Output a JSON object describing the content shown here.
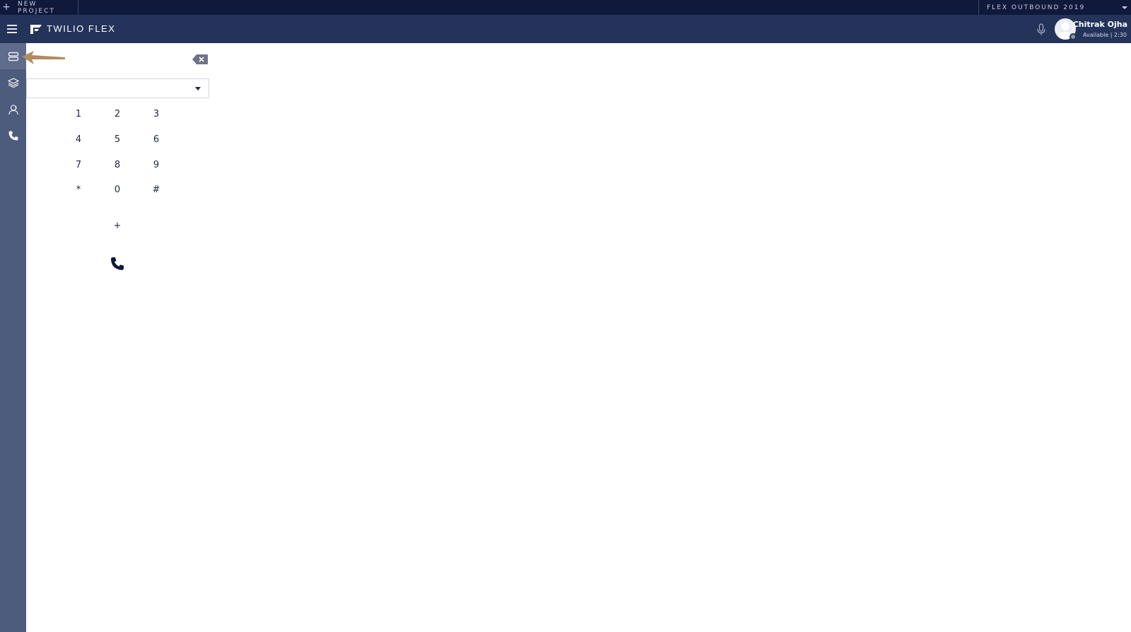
{
  "project_bar": {
    "new_project_label": "NEW PROJECT",
    "project_name": "FLEX OUTBOUND 2019"
  },
  "header": {
    "brand": "TWILIO FLEX",
    "user_name": "Chitrak Ojha",
    "user_status": "Available | 2:30"
  },
  "sidebar": {
    "items": [
      {
        "icon": "agent-desktop-icon",
        "active": true
      },
      {
        "icon": "layers-icon",
        "active": false
      },
      {
        "icon": "contacts-icon",
        "active": false
      },
      {
        "icon": "phone-icon",
        "active": false
      }
    ]
  },
  "dialpad": {
    "number_value": "",
    "keys": [
      "1",
      "2",
      "3",
      "4",
      "5",
      "6",
      "7",
      "8",
      "9",
      "*",
      "0",
      "#"
    ],
    "plus_key": "+"
  },
  "colors": {
    "project_bar": "#10193a",
    "header": "#233359",
    "sidebar": "#4d5b7c",
    "annotation_arrow": "#b38b5d"
  }
}
